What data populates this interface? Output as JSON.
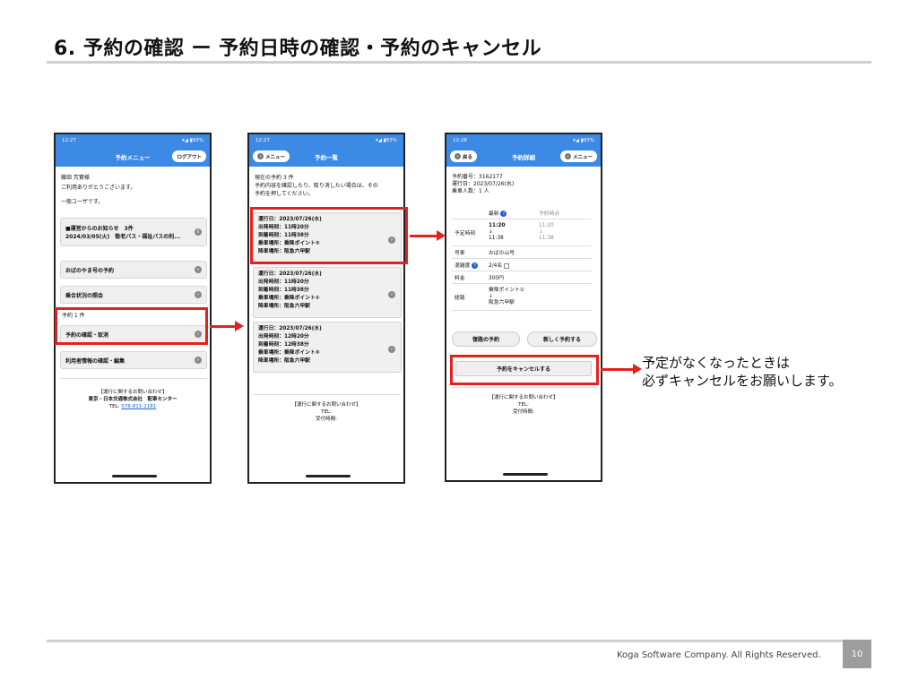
{
  "slide": {
    "title": "6. 予約の確認 ー 予約日時の確認・予約のキャンセル",
    "note_line1": "予定がなくなったときは",
    "note_line2": "必ずキャンセルをお願いします。",
    "footer": "Koga Software Company. All Rights Reserved.",
    "page_number": "10"
  },
  "colors": {
    "app_blue": "#3d8ae6",
    "highlight_red": "#e3221d",
    "link_blue": "#1a62d6"
  },
  "screen1": {
    "time": "12:27",
    "battery": "93%",
    "title": "予約メニュー",
    "logout": "ログアウト",
    "user_name": "藤田 芳實様",
    "thanks": "ご利用ありがとうございます。",
    "user_type": "一般ユーザです。",
    "notice_title": "■運営からのお知らせ　3件",
    "notice_detail": "2024/03/05(火)　敬老パス・福祉パスの利...",
    "menu_ohanoyama": "おばのやま号の予約",
    "menu_congestion": "乗合状況の照会",
    "reservation_count": "予約 1 件",
    "menu_confirm_cancel": "予約の確認・取消",
    "menu_user_info": "利用者情報の確認・編集",
    "contact_header": "【運行に関するお問い合わせ】",
    "contact_company": "東京・日本交通株式会社　配車センター",
    "tel_label": "TEL:",
    "tel_number": "078-811-2181"
  },
  "screen2": {
    "time": "12:27",
    "battery": "93%",
    "title": "予約一覧",
    "back": "メニュー",
    "intro1": "現在の予約 3 件",
    "intro2": "予約内容を確認したり、取り消したい場合は、その",
    "intro3": "予約を押してください。",
    "reservations": [
      {
        "date": "運行日：2023/07/26(水)",
        "dep": "出発時刻：11時20分",
        "arr": "到着時刻：11時38分",
        "board": "乗車場所：乗降ポイント③",
        "alight": "降車場所：阪急六甲駅"
      },
      {
        "date": "運行日：2023/07/26(水)",
        "dep": "出発時刻：11時20分",
        "arr": "到着時刻：11時38分",
        "board": "乗車場所：乗降ポイント①",
        "alight": "降車場所：阪急六甲駅"
      },
      {
        "date": "運行日：2023/07/26(水)",
        "dep": "出発時刻：12時20分",
        "arr": "到着時刻：12時38分",
        "board": "乗車場所：乗降ポイント③",
        "alight": "降車場所：阪急六甲駅"
      }
    ],
    "contact_header": "【運行に関するお問い合わせ】",
    "tel_label": "TEL:",
    "hours_label": "受付時間:"
  },
  "screen3": {
    "time": "12:28",
    "battery": "93%",
    "title": "予約詳細",
    "back": "戻る",
    "menu": "メニュー",
    "reservation_no": "予約番号：3162177",
    "operation_date": "運行日：2023/07/26(水)",
    "passengers": "乗車人数：1 人",
    "col_latest": "最新",
    "col_at_booking": "予約時点",
    "row_time_label": "予定時刻",
    "latest_dep": "11:20",
    "latest_arrow": "↓",
    "latest_arr": "11:38",
    "booking_dep": "11:20",
    "booking_arrow": "↓",
    "booking_arr": "11:38",
    "row_vehicle_label": "号車",
    "vehicle": "おばの山号",
    "row_congestion_label": "混雑度",
    "congestion": "2/4名",
    "row_fare_label": "料金",
    "fare": "300円",
    "row_route_label": "経路",
    "route_from": "乗降ポイント①",
    "route_arrow": "↓",
    "route_to": "阪急六甲駅",
    "btn_return": "復路の予約",
    "btn_new": "新しく予約する",
    "btn_cancel": "予約をキャンセルする",
    "contact_header": "【運行に関するお問い合わせ】",
    "tel_label": "TEL:",
    "hours_label": "受付時間:"
  }
}
